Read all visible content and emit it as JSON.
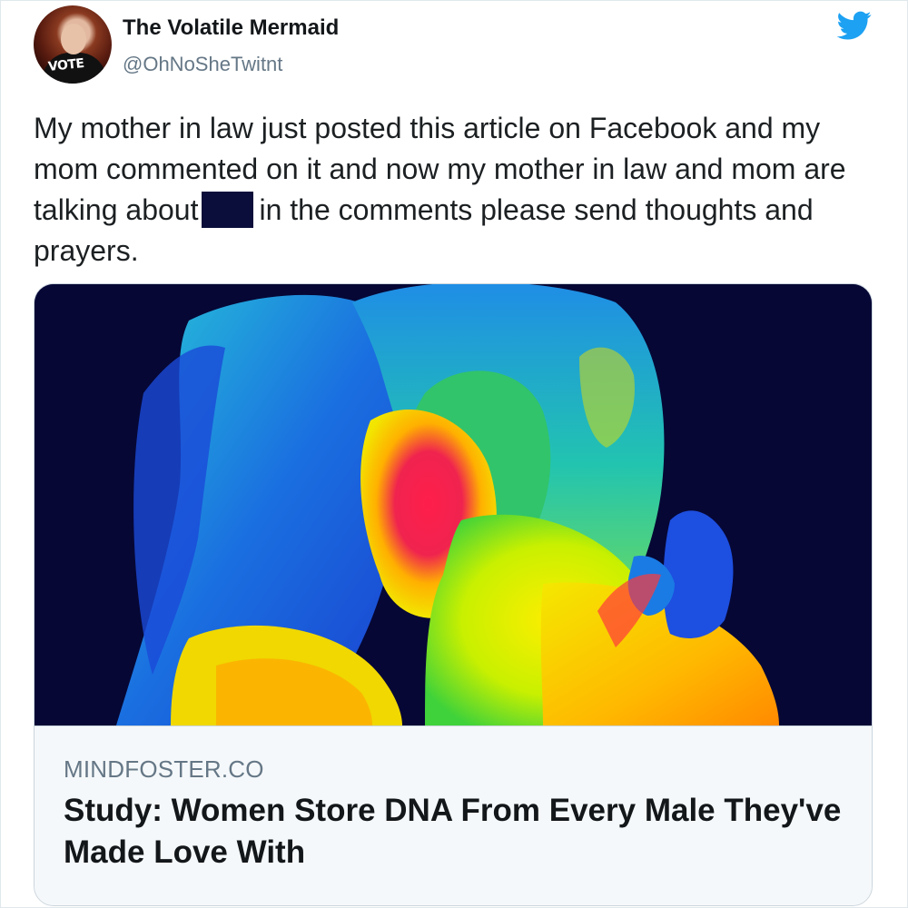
{
  "author": {
    "display_name": "The Volatile Mermaid",
    "handle": "@OhNoSheTwitnt",
    "avatar_badge_text": "VOTE"
  },
  "platform_icon": "twitter-bird-icon",
  "tweet": {
    "text_before_redaction": "My mother in law just posted this article on Facebook and my mom commented on it and now my mother in law and mom are talking about",
    "text_after_redaction": "in the comments please send thoughts and prayers."
  },
  "link_card": {
    "image_description_icon": "thermal-image",
    "domain": "MINDFOSTER.CO",
    "title": "Study: Women Store DNA From Every Male They've Made Love With"
  },
  "colors": {
    "twitter_blue": "#1da1f2",
    "text_primary": "#14171a",
    "text_secondary": "#657786",
    "redaction": "#0b0e3a",
    "card_border": "#ccd6dd"
  }
}
